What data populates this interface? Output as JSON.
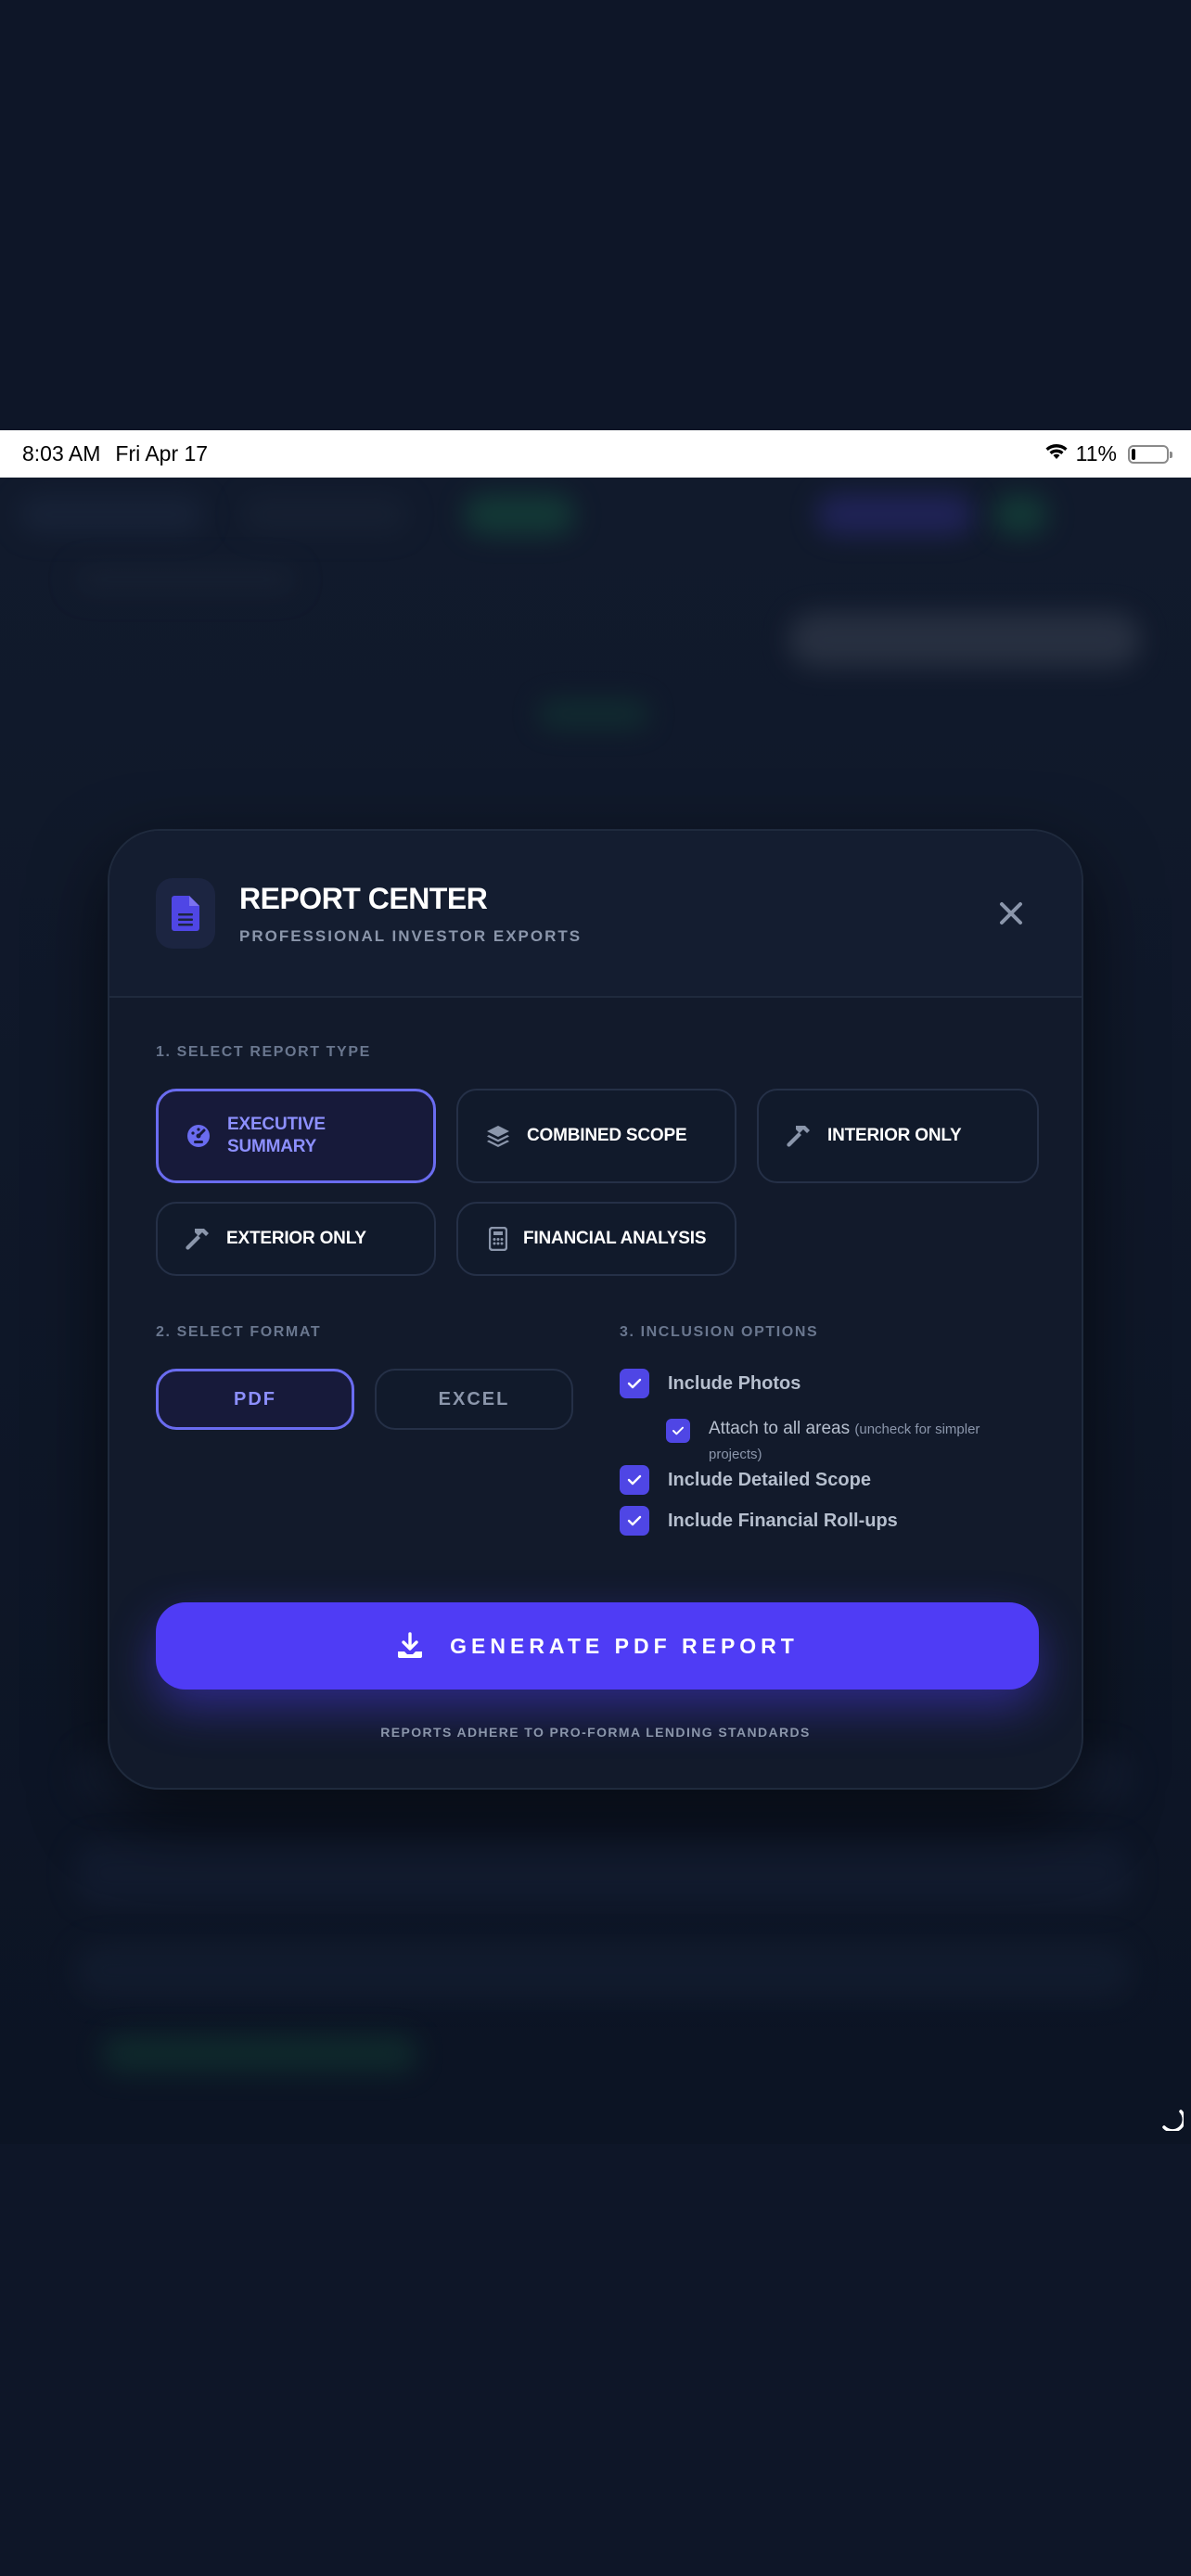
{
  "status_bar": {
    "time": "8:03 AM",
    "date": "Fri Apr 17",
    "battery": "11%",
    "battery_level": 0.11
  },
  "modal": {
    "title": "REPORT CENTER",
    "subtitle": "PROFESSIONAL INVESTOR EXPORTS",
    "icons": {
      "header": "document-icon",
      "close": "close-icon"
    }
  },
  "report_type": {
    "label": "1. SELECT REPORT TYPE",
    "options": [
      {
        "label": "EXECUTIVE SUMMARY",
        "icon": "gauge-icon",
        "selected": true
      },
      {
        "label": "COMBINED SCOPE",
        "icon": "layers-icon",
        "selected": false
      },
      {
        "label": "INTERIOR ONLY",
        "icon": "hammer-icon",
        "selected": false
      },
      {
        "label": "EXTERIOR ONLY",
        "icon": "hammer-icon",
        "selected": false
      },
      {
        "label": "FINANCIAL ANALYSIS",
        "icon": "calculator-icon",
        "selected": false
      }
    ]
  },
  "format": {
    "label": "2. SELECT FORMAT",
    "options": [
      {
        "label": "PDF",
        "selected": true
      },
      {
        "label": "EXCEL",
        "selected": false
      }
    ]
  },
  "inclusion": {
    "label": "3. INCLUSION OPTIONS",
    "options": [
      {
        "label": "Include Photos",
        "checked": true
      },
      {
        "label": "Attach to all areas",
        "hint": "(uncheck for simpler projects)",
        "checked": true
      },
      {
        "label": "Include Detailed Scope",
        "checked": true
      },
      {
        "label": "Include Financial Roll-ups",
        "checked": true
      }
    ]
  },
  "generate_button": {
    "label": "GENERATE PDF REPORT",
    "icon": "download-icon"
  },
  "footnote": "REPORTS ADHERE TO PRO-FORMA LENDING STANDARDS",
  "colors": {
    "background": "#0e1628",
    "modal": "#121a2b",
    "accent": "#4f3cf5",
    "selected_border": "#6a6cf0",
    "selected_text": "#8d90ff"
  }
}
